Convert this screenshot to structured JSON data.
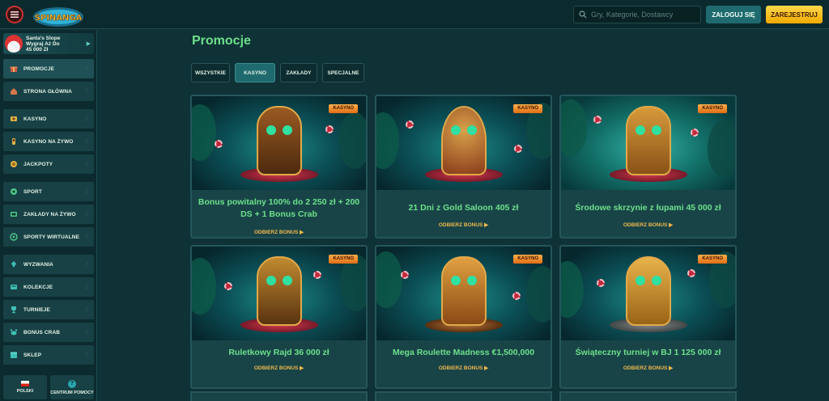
{
  "header": {
    "logo_text": "SPINANGA",
    "search_placeholder": "Gry, Kategorie, Dostawcy",
    "login_label": "ZALOGUJ SIĘ",
    "register_label": "ZAREJESTRUJ"
  },
  "sidebar": {
    "promo_banner": {
      "line1": "Santa's Slope",
      "line2": "Wygraj Aż Do",
      "line3": "45 000 Zł"
    },
    "items": [
      {
        "label": "PROMOCJE",
        "icon": "gift-icon"
      },
      {
        "label": "STRONA GŁÓWNA",
        "icon": "home-icon"
      },
      {
        "label": "KASYNO",
        "icon": "casino-icon"
      },
      {
        "label": "KASYNO NA ŻYWO",
        "icon": "live-casino-icon"
      },
      {
        "label": "JACKPOTY",
        "icon": "jackpot-icon"
      },
      {
        "label": "SPORT",
        "icon": "sport-icon"
      },
      {
        "label": "ZAKŁADY NA ŻYWO",
        "icon": "live-bets-icon"
      },
      {
        "label": "SPORTY WIRTUALNE",
        "icon": "virtual-sports-icon"
      },
      {
        "label": "WYZWANIA",
        "icon": "challenges-icon"
      },
      {
        "label": "KOLEKCJE",
        "icon": "collections-icon"
      },
      {
        "label": "TURNIEJE",
        "icon": "trophy-icon"
      },
      {
        "label": "BONUS CRAB",
        "icon": "crab-icon"
      },
      {
        "label": "SKLEP",
        "icon": "shop-icon"
      }
    ],
    "language_label": "POLSKI",
    "help_label": "CENTRUM POMOCY"
  },
  "main": {
    "title": "Promocje",
    "tabs": [
      "WSZYSTKIE",
      "KASYNO",
      "ZAKŁADY",
      "SPECJALNE"
    ],
    "active_tab": "KASYNO",
    "cards": [
      {
        "badge": "KASYNO",
        "title": "Bonus powitalny 100% do 2 250 zł + 200 DS + 1 Bonus Crab",
        "cta": "ODBIERZ BONUS ▶"
      },
      {
        "badge": "KASYNO",
        "title": "21 Dni z Gold Saloon 405 zł",
        "cta": "ODBIERZ BONUS ▶"
      },
      {
        "badge": "KASYNO",
        "title": "Środowe skrzynie z łupami 45 000 zł",
        "cta": "ODBIERZ BONUS ▶"
      },
      {
        "badge": "KASYNO",
        "title": "Ruletkowy Rajd 36 000 zł",
        "cta": "ODBIERZ BONUS ▶"
      },
      {
        "badge": "KASYNO",
        "title": "Mega Roulette Madness €1,500,000",
        "cta": "ODBIERZ BONUS ▶"
      },
      {
        "badge": "KASYNO",
        "title": "Świąteczny turniej w BJ 1 125 000 zł",
        "cta": "ODBIERZ BONUS ▶"
      }
    ]
  },
  "colors": {
    "background": "#0f3236",
    "accent_green": "#6de08a",
    "cta_orange": "#f2b84a",
    "register_yellow": "#f0a900",
    "badge_orange": "#e06d15"
  }
}
